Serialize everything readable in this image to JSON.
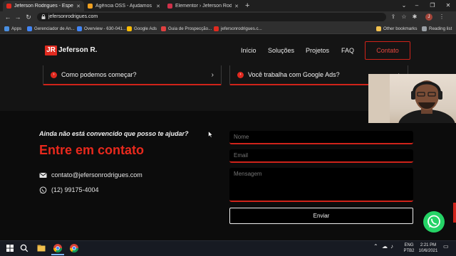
{
  "browser": {
    "tabs": [
      {
        "label": "Jeferson Rodrigues - Especialist",
        "favicon_color": "#e02a1f",
        "active": true
      },
      {
        "label": "Agência OSS - Ajudamos o seu n",
        "favicon_color": "#f0a020",
        "active": false
      },
      {
        "label": "Elementor › Jeferson Rodrigues",
        "favicon_color": "#d0314a",
        "active": false
      }
    ],
    "new_tab": "+",
    "url": "jefersonrodrigues.com",
    "profile_initial": "J",
    "bookmarks": [
      {
        "label": "Apps",
        "icon_color": "#4a90e2"
      },
      {
        "label": "Gerenciador de An...",
        "icon_color": "#4285f4"
      },
      {
        "label": "Overview - 630-041...",
        "icon_color": "#4285f4"
      },
      {
        "label": "Google Ads",
        "icon_color": "#fbbc04"
      },
      {
        "label": "Guia de Prospecção...",
        "icon_color": "#e04040"
      },
      {
        "label": "jefersonrodrigues.c...",
        "icon_color": "#e02a1f"
      }
    ],
    "other_bookmarks": "Other bookmarks",
    "reading_list": "Reading list"
  },
  "site": {
    "logo_mark": "JR",
    "logo_text": "Jeferson R.",
    "nav": [
      "Início",
      "Soluções",
      "Projetos",
      "FAQ"
    ],
    "cta": "Contato",
    "faq": [
      {
        "question": "Como podemos começar?"
      },
      {
        "question": "Você trabalha com Google Ads?"
      }
    ],
    "contact": {
      "kicker": "Ainda não está convencido que posso te ajudar?",
      "headline": "Entre em contato",
      "email": "contato@jefersonrodrigues.com",
      "phone": "(12) 99175-4004"
    },
    "form": {
      "name_placeholder": "Nome",
      "email_placeholder": "Email",
      "message_placeholder": "Mensagem",
      "submit": "Enviar"
    },
    "accent_color": "#d0231a"
  },
  "taskbar": {
    "lang": "ENG",
    "keyboard": "PTB2",
    "time": "2:21 PM",
    "date": "10/6/2021"
  }
}
